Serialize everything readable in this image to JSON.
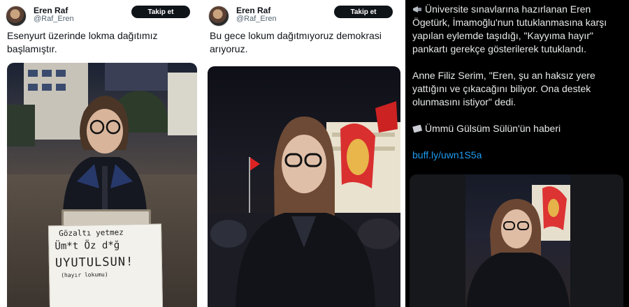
{
  "tweet1": {
    "author_name": "Eren Raf",
    "author_handle": "@Raf_Eren",
    "follow_label": "Takip et",
    "text": "Esenyurt üzerinde lokma dağıtımız başlamıştır.",
    "sign": {
      "line1": "Gözaltı yetmez",
      "line2": "Üm*t Öz d*ğ",
      "line3": "UYUTULSUN!",
      "line4": "(hayır lokumu)"
    }
  },
  "tweet2": {
    "author_name": "Eren Raf",
    "author_handle": "@Raf_Eren",
    "follow_label": "Takip et",
    "text": "Bu gece lokum dağıtmıyoruz demokrasi arıyoruz."
  },
  "tweet3": {
    "para1": "Üniversite sınavlarına hazırlanan Eren Ögetürk, İmamoğlu'nun tutuklanmasına karşı yapılan eylemde taşıdığı, \"Kayyıma hayır\" pankartı gerekçe gösterilerek tutuklandı.",
    "para2": "Anne Filiz Serim, \"Eren, şu an haksız yere yattığını ve çıkacağını biliyor. Ona destek olunmasını istiyor\" dedi.",
    "para3": "Ümmü Gülsüm Sülün'ün haberi",
    "link": "buff.ly/uwn1S5a",
    "link_color": "#1d9bf0",
    "icon1": "megaphone-icon",
    "icon2": "newspaper-icon"
  },
  "colors": {
    "follow_bg": "#0f1419",
    "dark_bg": "#000000"
  }
}
